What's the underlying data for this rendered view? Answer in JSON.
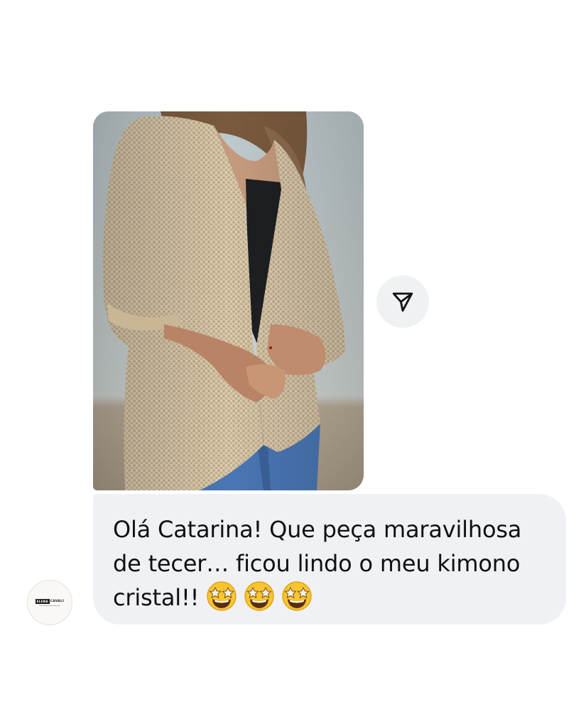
{
  "conversation": {
    "photo_message": {
      "alt": "Photo of a woman wearing a beige crochet kimono cardigan"
    },
    "share_button": {
      "icon": "send-icon"
    },
    "text_message": {
      "text": "Olá Catarina! Que peça maravilhosa de tecer… ficou lindo o meu kimono cristal!!",
      "emoji": [
        "star-struck-emoji",
        "star-struck-emoji",
        "star-struck-emoji"
      ]
    },
    "sender_avatar": {
      "logo_left": "ELENA",
      "logo_right": "CAVALI"
    }
  },
  "colors": {
    "bubble_background": "#f0f1f4",
    "share_button_background": "#f0f1f3",
    "text": "#111111"
  }
}
